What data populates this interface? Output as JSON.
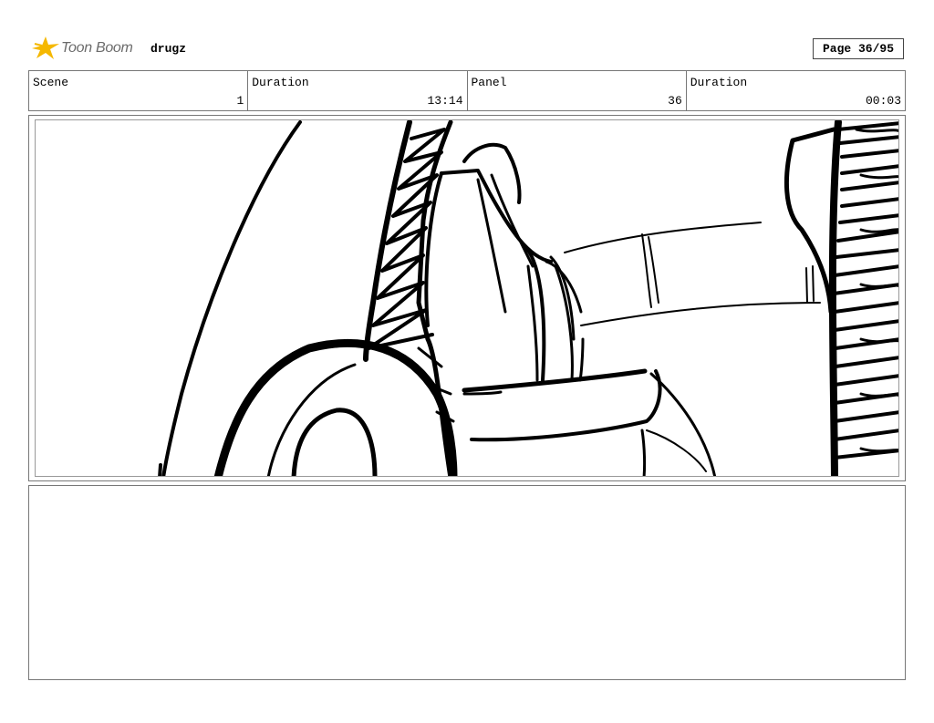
{
  "header": {
    "logo_icon": "star-burst-icon",
    "brand": "Toon Boom",
    "project": "drugz",
    "page": "Page 36/95"
  },
  "info": {
    "scene_label": "Scene",
    "scene_value": "1",
    "scene_duration_label": "Duration",
    "scene_duration_value": "13:14",
    "panel_label": "Panel",
    "panel_value": "36",
    "panel_duration_label": "Duration",
    "panel_duration_value": "00:03"
  },
  "colors": {
    "logo_star": "#f5b800",
    "border": "#777777"
  }
}
